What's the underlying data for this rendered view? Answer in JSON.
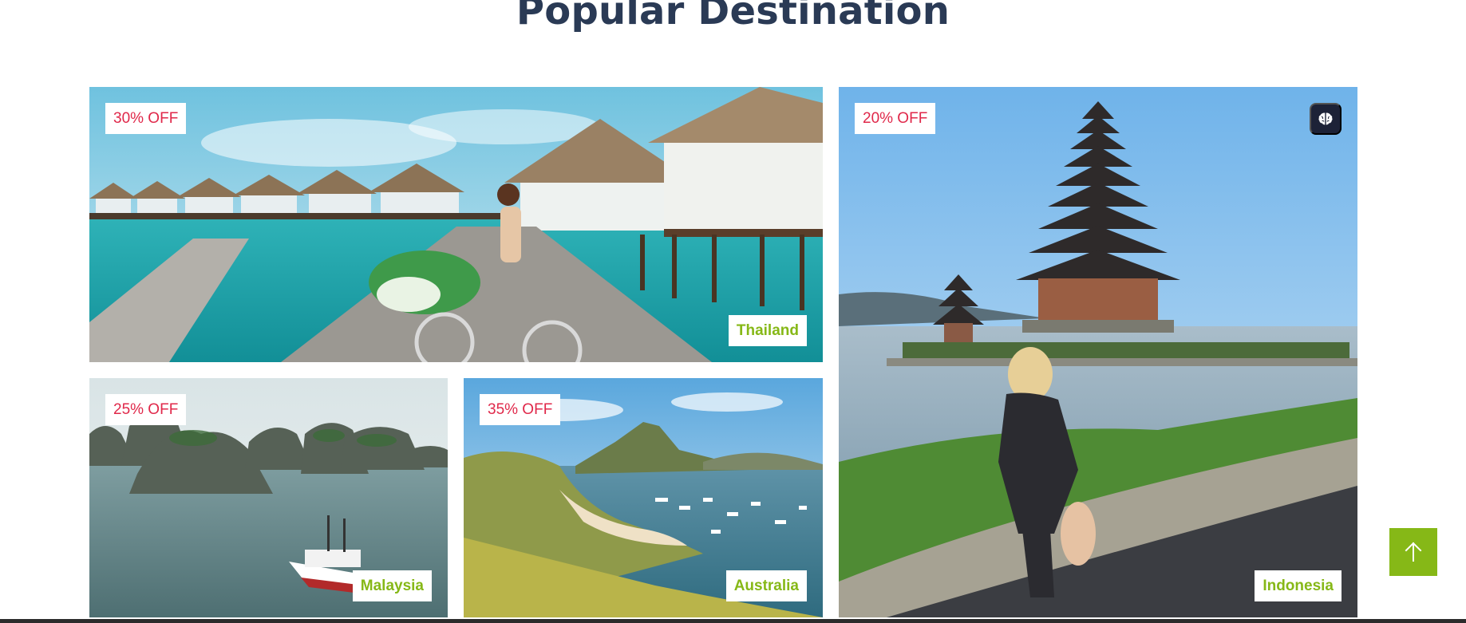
{
  "section": {
    "title": "Popular Destination"
  },
  "destinations": [
    {
      "location": "Thailand",
      "discount": "30% OFF"
    },
    {
      "location": "Malaysia",
      "discount": "25% OFF"
    },
    {
      "location": "Australia",
      "discount": "35% OFF"
    },
    {
      "location": "Indonesia",
      "discount": "20% OFF"
    }
  ],
  "icons": {
    "chip": "brain-icon",
    "back_to_top": "arrow-up-icon"
  },
  "colors": {
    "title": "#2a3a55",
    "discount_text": "#e0284a",
    "location_text": "#86b817",
    "back_to_top_bg": "#86b817",
    "chip_bg": "#1d2237"
  }
}
